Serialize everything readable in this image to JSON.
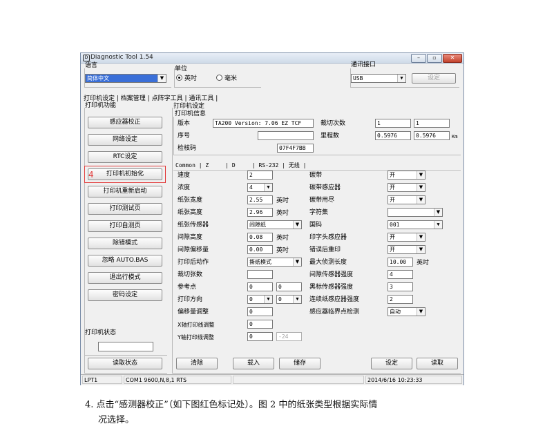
{
  "window": {
    "title": "Diagnostic Tool 1.54",
    "controls": {
      "minimize": "–",
      "maximize": "▫",
      "close": "✕"
    }
  },
  "language": {
    "label": "语言",
    "value": "简体中文"
  },
  "unit": {
    "label": "单位",
    "inch": "英吋",
    "mm": "毫米"
  },
  "comm_port": {
    "label": "通讯接口",
    "value": "USB",
    "set_button": "设定"
  },
  "main_tabs": [
    "打印机设定",
    "档案管理",
    "点阵字工具",
    "通讯工具"
  ],
  "printer_functions": {
    "label": "打印机功能",
    "buttons": [
      "感应器校正",
      "网络设定",
      "RTC设定",
      "打印机初始化",
      "打印机重新启动",
      "打印测试页",
      "打印自测页",
      "除错模式",
      "忽略 AUTO.BAS",
      "退出行模式",
      "密码设定"
    ],
    "marker": "4"
  },
  "printer_status": {
    "label": "打印机状态",
    "value": "",
    "read_button": "读取状态"
  },
  "printer_settings": {
    "label": "打印机设定"
  },
  "printer_info": {
    "label": "打印机信息",
    "version_label": "版本",
    "version_value": "TA200 Version: 7.06 EZ TCF",
    "serial_label": "序号",
    "serial_value": "",
    "checksum_label": "检核码",
    "checksum_value": "07F4F7BB",
    "cut_count_label": "裁切次数",
    "cut_count_1": "1",
    "cut_count_2": "1",
    "mileage_label": "里程数",
    "mileage_1": "0.5976",
    "mileage_2": "0.5976",
    "mileage_unit": "Km"
  },
  "sub_tabs": [
    "Common",
    "Z",
    "D",
    "RS-232",
    "无线"
  ],
  "left_fields": [
    {
      "label": "速度",
      "value": "2",
      "kind": "input"
    },
    {
      "label": "浓度",
      "value": "4",
      "kind": "select"
    },
    {
      "label": "纸张宽度",
      "value": "2.55",
      "unit": "英吋",
      "kind": "input"
    },
    {
      "label": "纸张高度",
      "value": "2.96",
      "unit": "英吋",
      "kind": "input"
    },
    {
      "label": "纸张传感器",
      "value": "间隙纸",
      "kind": "select"
    },
    {
      "label": "间隙高度",
      "value": "0.08",
      "unit": "英吋",
      "kind": "input"
    },
    {
      "label": "间隙偏移量",
      "value": "0.00",
      "unit": "英吋",
      "kind": "input"
    },
    {
      "label": "打印后动作",
      "value": "撕纸模式",
      "kind": "select"
    },
    {
      "label": "裁切张数",
      "value": "",
      "kind": "input"
    },
    {
      "label": "参考点",
      "value": "0",
      "value2": "0",
      "kind": "pair"
    },
    {
      "label": "打印方向",
      "value": "0",
      "value2": "0",
      "kind": "selpair"
    },
    {
      "label": "偏移量调整",
      "value": "0",
      "kind": "input"
    },
    {
      "label": "X轴打印线调整",
      "value": "0",
      "kind": "input"
    },
    {
      "label": "Y轴打印线调整",
      "value": "0",
      "value2": "-24",
      "kind": "pairdis"
    }
  ],
  "right_fields": [
    {
      "label": "碳带",
      "value": "开",
      "kind": "select"
    },
    {
      "label": "碳带感应器",
      "value": "开",
      "kind": "select"
    },
    {
      "label": "碳带用尽",
      "value": "开",
      "kind": "select"
    },
    {
      "label": "字符集",
      "value": "",
      "kind": "select"
    },
    {
      "label": "国码",
      "value": "001",
      "kind": "select"
    },
    {
      "label": "印字头感应器",
      "value": "开",
      "kind": "select"
    },
    {
      "label": "错误后重印",
      "value": "开",
      "kind": "select"
    },
    {
      "label": "最大侦测长度",
      "value": "10.00",
      "unit": "英吋",
      "kind": "input"
    },
    {
      "label": "间隙传感器强度",
      "value": "4",
      "kind": "input"
    },
    {
      "label": "黑标传感器强度",
      "value": "3",
      "kind": "input"
    },
    {
      "label": "连续纸感应器强度",
      "value": "2",
      "kind": "input"
    },
    {
      "label": "感应器临界点检测",
      "value": "自动",
      "kind": "select"
    }
  ],
  "bottom_buttons": {
    "clear": "清除",
    "load": "载入",
    "save": "储存",
    "set": "设定",
    "read": "读取"
  },
  "status_bar": {
    "port": "LPT1",
    "comm": "COM1 9600,N,8,1 RTS",
    "middle": "",
    "datetime": "2014/6/16 10:23:33"
  },
  "caption": {
    "line1": "4. 点击“感测器校正”（如下图红色标记处）。图 2 中的纸张类型根据实际情",
    "line2": "况选择。"
  }
}
